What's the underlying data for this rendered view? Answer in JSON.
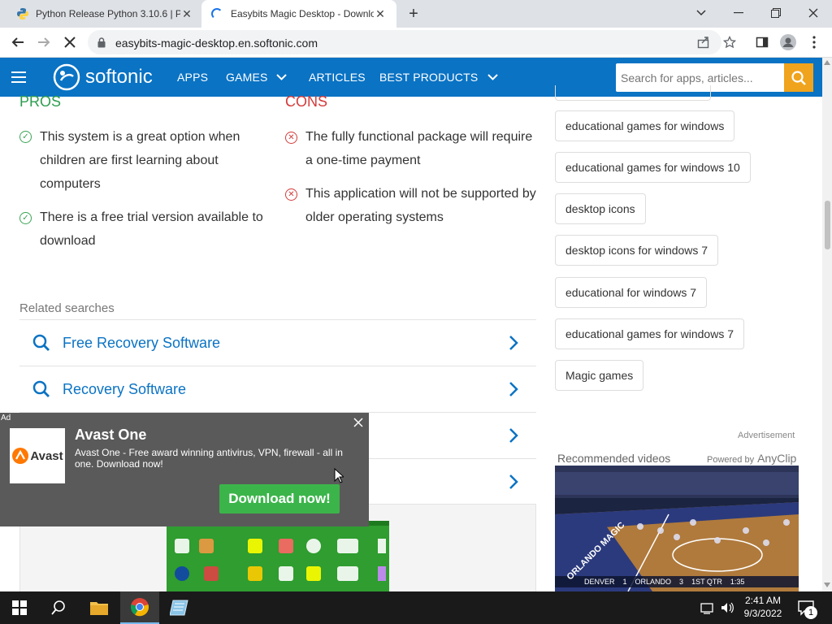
{
  "browser": {
    "tabs": [
      {
        "title": "Python Release Python 3.10.6 | P",
        "icon": "python-icon"
      },
      {
        "title": "Easybits Magic Desktop - Downlo",
        "icon": "loading-icon"
      }
    ],
    "url": "easybits-magic-desktop.en.softonic.com"
  },
  "site": {
    "logo_text": "softonic",
    "nav": [
      "APPS",
      "GAMES",
      "ARTICLES",
      "BEST PRODUCTS"
    ],
    "search_placeholder": "Search for apps, articles..."
  },
  "pros": {
    "title": "PROS",
    "items": [
      "This system is a great option when children are first learning about computers",
      "There is a free trial version available to download"
    ]
  },
  "cons": {
    "title": "CONS",
    "items": [
      "The fully functional package will require a one-time payment",
      "This application will not be supported by older operating systems"
    ]
  },
  "related": {
    "title": "Related searches",
    "items": [
      "Free Recovery Software",
      "Recovery Software"
    ]
  },
  "tags": [
    "educational games for windows",
    "educational games for windows 10",
    "desktop icons",
    "desktop icons for windows 7",
    "educational for windows 7",
    "educational games for windows 7",
    "Magic games"
  ],
  "advertisement_label": "Advertisement",
  "videos": {
    "title": "Recommended videos",
    "powered_prefix": "Powered by",
    "powered_brand": "AnyClip",
    "score": {
      "left_team": "DENVER",
      "left_score": "1",
      "right_team": "ORLANDO",
      "right_score": "3",
      "period": "1ST QTR",
      "clock": "1:35"
    },
    "court_text": "ORLANDO MAGIC"
  },
  "ad": {
    "label": "Ad",
    "brand": "Avast",
    "title": "Avast One",
    "text": "Avast One - Free award winning antivirus, VPN, firewall - all in one. Download now!",
    "button": "Download now!"
  },
  "taskbar": {
    "time": "2:41 AM",
    "date": "9/3/2022",
    "notification_count": "1"
  },
  "colors": {
    "brand": "#0a73c4",
    "cons_red": "#d33a3a",
    "search_btn": "#f0a31c",
    "ad_button": "#3bb54a"
  }
}
